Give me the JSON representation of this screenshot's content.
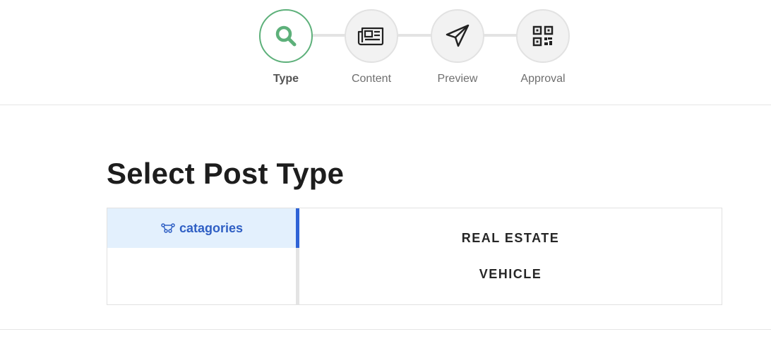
{
  "stepper": {
    "steps": [
      {
        "label": "Type",
        "icon": "search-icon",
        "active": true
      },
      {
        "label": "Content",
        "icon": "newspaper-icon",
        "active": false
      },
      {
        "label": "Preview",
        "icon": "send-icon",
        "active": false
      },
      {
        "label": "Approval",
        "icon": "qr-code-icon",
        "active": false
      }
    ]
  },
  "main": {
    "title": "Select Post Type",
    "tab": {
      "label": "catagories",
      "icon": "categories-icon"
    },
    "options": [
      "REAL ESTATE",
      "VEHICLE"
    ]
  },
  "colors": {
    "active_step": "#5db07a",
    "tab_background": "#e3f0fd",
    "tab_text": "#2f5fc4",
    "tab_accent": "#2f63d6"
  }
}
